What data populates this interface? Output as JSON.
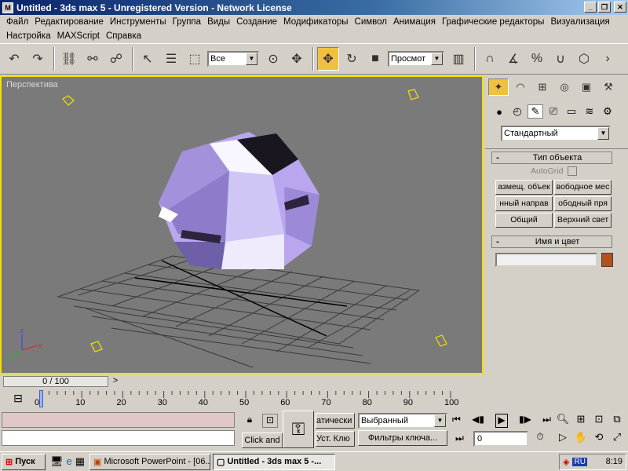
{
  "window": {
    "title": "Untitled - 3ds max 5 - Unregistered Version - Network License",
    "app_icon": "3ds-max-icon",
    "controls": [
      "minimize",
      "maximize",
      "close"
    ]
  },
  "menu": {
    "row1": [
      "Файл",
      "Редактирование",
      "Инструменты",
      "Группа",
      "Виды",
      "Создание",
      "Модификаторы",
      "Символ",
      "Анимация",
      "Графические редакторы",
      "Визуализация"
    ],
    "row2": [
      "Настройка",
      "MAXScript",
      "Справка"
    ]
  },
  "toolbar": {
    "selection_filter": "Все",
    "reference_coord": "Просмот"
  },
  "viewport": {
    "label": "Перспектива",
    "active_border_color": "#f4e000",
    "background_color": "#7a7a7a",
    "object": "geosphere-polyhedron",
    "object_color": "#b9a6ee"
  },
  "command_panel": {
    "category_dropdown": "Стандартный",
    "object_type": {
      "title": "Тип объекта",
      "autogrid": "AutoGrid",
      "buttons": [
        "азмещ. объек",
        "вободное мес",
        "нный направ",
        "ободный пря",
        "Общий",
        "Верхний свет"
      ]
    },
    "name_color": {
      "title": "Имя и цвет",
      "name_value": "",
      "swatch_color": "#b5501a"
    }
  },
  "timeline": {
    "slider_label": "0 / 100",
    "ticks": [
      "0",
      "10",
      "20",
      "30",
      "40",
      "50",
      "60",
      "70",
      "80",
      "90",
      "100"
    ]
  },
  "bottom": {
    "click_and": "Click and",
    "auto_key": "атически",
    "set_key": "Уст. Клю",
    "key_mode": "Выбранный",
    "key_filters": "Фильтры ключа...",
    "frame_value": "0"
  },
  "taskbar": {
    "start": "Пуск",
    "tasks": [
      "Microsoft PowerPoint - [06...",
      "Untitled - 3ds max 5 -..."
    ],
    "language": "RU",
    "clock": "8:19"
  }
}
